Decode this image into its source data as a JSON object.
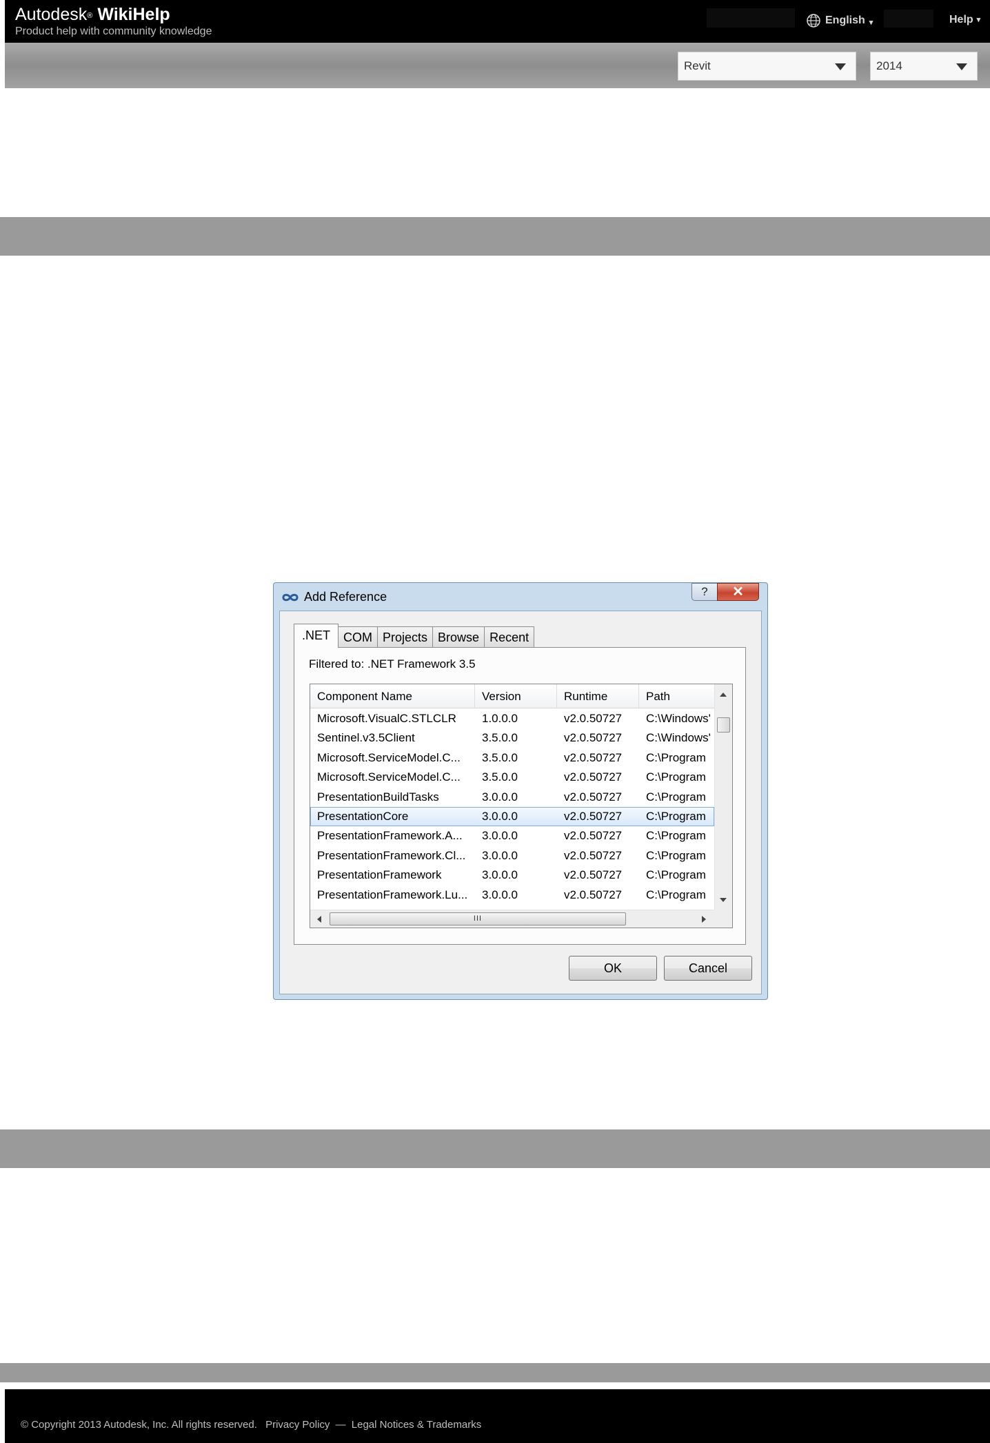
{
  "header": {
    "brand_prefix": "Autodesk",
    "brand_reg": "®",
    "brand_name": "WikiHelp",
    "tagline": "Product help with community knowledge",
    "language": "English",
    "help": "Help",
    "caret": "▾"
  },
  "product_bar": {
    "product": "Revit",
    "year": "2014"
  },
  "dialog": {
    "title": "Add Reference",
    "help_button": "?",
    "close_button": "✕",
    "tabs": [
      ".NET",
      "COM",
      "Projects",
      "Browse",
      "Recent"
    ],
    "active_tab": ".NET",
    "filter_text": "Filtered to: .NET Framework 3.5",
    "columns": [
      "Component Name",
      "Version",
      "Runtime",
      "Path"
    ],
    "rows": [
      [
        "Microsoft.VisualC.STLCLR",
        "1.0.0.0",
        "v2.0.50727",
        "C:\\Windows'"
      ],
      [
        "Sentinel.v3.5Client",
        "3.5.0.0",
        "v2.0.50727",
        "C:\\Windows'"
      ],
      [
        "Microsoft.ServiceModel.C...",
        "3.5.0.0",
        "v2.0.50727",
        "C:\\Program"
      ],
      [
        "Microsoft.ServiceModel.C...",
        "3.5.0.0",
        "v2.0.50727",
        "C:\\Program"
      ],
      [
        "PresentationBuildTasks",
        "3.0.0.0",
        "v2.0.50727",
        "C:\\Program"
      ],
      [
        "PresentationCore",
        "3.0.0.0",
        "v2.0.50727",
        "C:\\Program"
      ],
      [
        "PresentationFramework.A...",
        "3.0.0.0",
        "v2.0.50727",
        "C:\\Program"
      ],
      [
        "PresentationFramework.Cl...",
        "3.0.0.0",
        "v2.0.50727",
        "C:\\Program"
      ],
      [
        "PresentationFramework",
        "3.0.0.0",
        "v2.0.50727",
        "C:\\Program"
      ],
      [
        "PresentationFramework.Lu...",
        "3.0.0.0",
        "v2.0.50727",
        "C:\\Program"
      ]
    ],
    "selected_row": "PresentationCore",
    "hscroll_grip": "III",
    "ok_label": "OK",
    "cancel_label": "Cancel"
  },
  "footer": {
    "copyright": "© Copyright 2013 Autodesk, Inc. All rights reserved.",
    "privacy": "Privacy Policy",
    "separator": "—",
    "legal": "Legal Notices & Trademarks"
  }
}
